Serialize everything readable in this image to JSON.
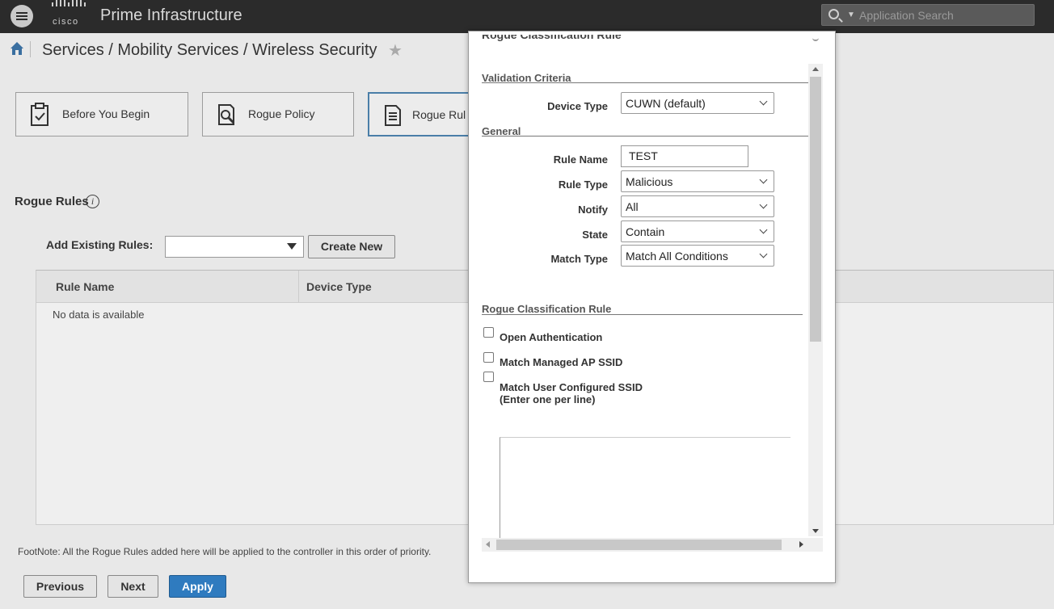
{
  "header": {
    "logo_text": "cisco",
    "app_title": "Prime Infrastructure",
    "search_placeholder": "Application Search"
  },
  "breadcrumb": "Services / Mobility Services / Wireless Security",
  "steps": [
    {
      "label": "Before You Begin"
    },
    {
      "label": "Rogue Policy"
    },
    {
      "label": "Rogue Rul"
    }
  ],
  "rules": {
    "title": "Rogue Rules",
    "add_label": "Add Existing Rules:",
    "add_value": "",
    "create_button": "Create New",
    "columns": [
      "Rule Name",
      "Device Type"
    ],
    "empty": "No data is available"
  },
  "footnote": "FootNote: All the Rogue Rules added here will be applied to the controller in this order of priority.",
  "footer_buttons": {
    "previous": "Previous",
    "next": "Next",
    "apply": "Apply"
  },
  "modal": {
    "heading": "Rogue Classification Rule",
    "validation_title": "Validation Criteria",
    "device_type_label": "Device Type",
    "device_type_value": "CUWN (default)",
    "general_title": "General",
    "rule_name_label": "Rule Name",
    "rule_name_value": "TEST",
    "rule_type_label": "Rule Type",
    "rule_type_value": "Malicious",
    "notify_label": "Notify",
    "notify_value": "All",
    "state_label": "State",
    "state_value": "Contain",
    "match_type_label": "Match Type",
    "match_type_value": "Match All Conditions",
    "classification_title": "Rogue Classification Rule",
    "checks": {
      "open_auth": "Open Authentication",
      "managed_ssid": "Match Managed AP SSID",
      "user_ssid_line1": "Match User Configured SSID",
      "user_ssid_line2": "(Enter one per line)"
    }
  },
  "colors": {
    "header_bg": "#2b2b2b",
    "apply_blue": "#2f7bbf",
    "active_step_border": "#4a7ea8"
  }
}
